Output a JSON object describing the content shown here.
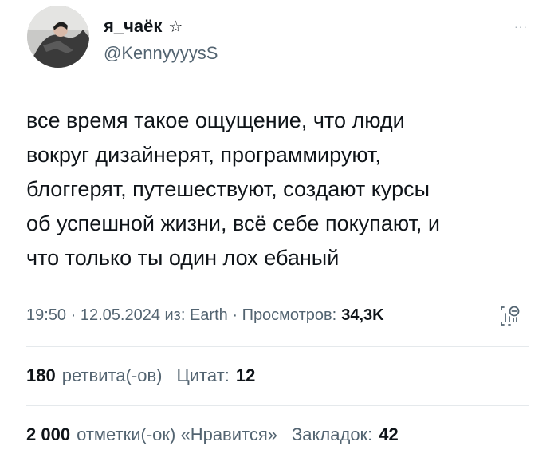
{
  "author": {
    "display_name": "я_чаёк",
    "badge": "☆",
    "handle": "@KennyyyysS"
  },
  "more_menu": "···",
  "tweet": {
    "text": "все время такое ощущение, что люди\nвокруг дизайнерят, программируют,\nблоггерят, путешествуют, создают курсы\nоб успешной жизни, всё себе покупают, и\nчто только ты один лох ебаный"
  },
  "meta": {
    "time": "19:50",
    "sep1": " · ",
    "date": "12.05.2024",
    "source": " из: Earth",
    "sep2": " · ",
    "views_label": "Просмотров:",
    "views_count": "34,3K"
  },
  "stats_row1": {
    "retweets_count": "180",
    "retweets_label": "ретвита(-ов)",
    "quotes_label": "Цитат:",
    "quotes_count": "12"
  },
  "stats_row2": {
    "likes_count": "2 000",
    "likes_label": "отметки(-ок) «Нравится»",
    "bookmarks_label": "Закладок:",
    "bookmarks_count": "42"
  },
  "icons": [
    "avatar-photo",
    "star-icon",
    "more-icon",
    "analytics-icon"
  ],
  "colors": {
    "text": "#0f1419",
    "secondary": "#536471",
    "divider": "#e5e9ec"
  }
}
